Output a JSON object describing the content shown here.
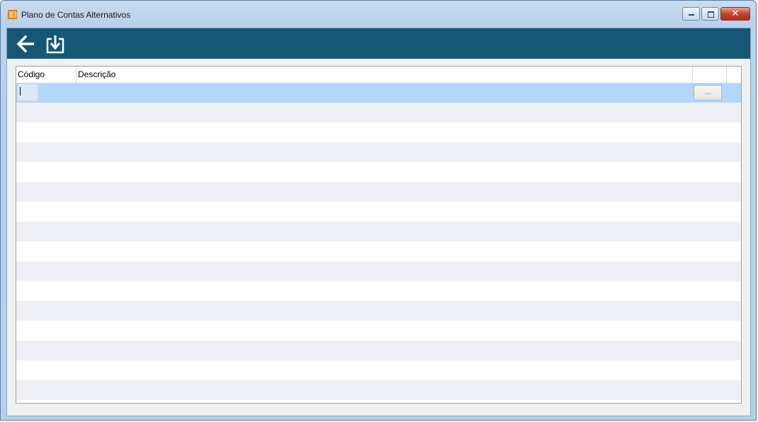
{
  "window": {
    "title": "Plano de Contas Alternativos",
    "controls": {
      "minimize": "minimize",
      "maximize": "maximize",
      "close": "✕"
    }
  },
  "toolbar": {
    "buttons": [
      {
        "name": "back",
        "icon": "arrow-left-icon"
      },
      {
        "name": "import",
        "icon": "download-tray-icon"
      }
    ],
    "background": "#165775"
  },
  "grid": {
    "columns": [
      {
        "key": "codigo",
        "label": "Código"
      },
      {
        "key": "descricao",
        "label": "Descrição"
      },
      {
        "key": "acao",
        "label": ""
      }
    ],
    "editor_row": {
      "codigo": "",
      "descricao": "",
      "action_label": "..."
    },
    "selection_color": "#b3d7f8",
    "alt_row_color": "#eef0f6"
  }
}
